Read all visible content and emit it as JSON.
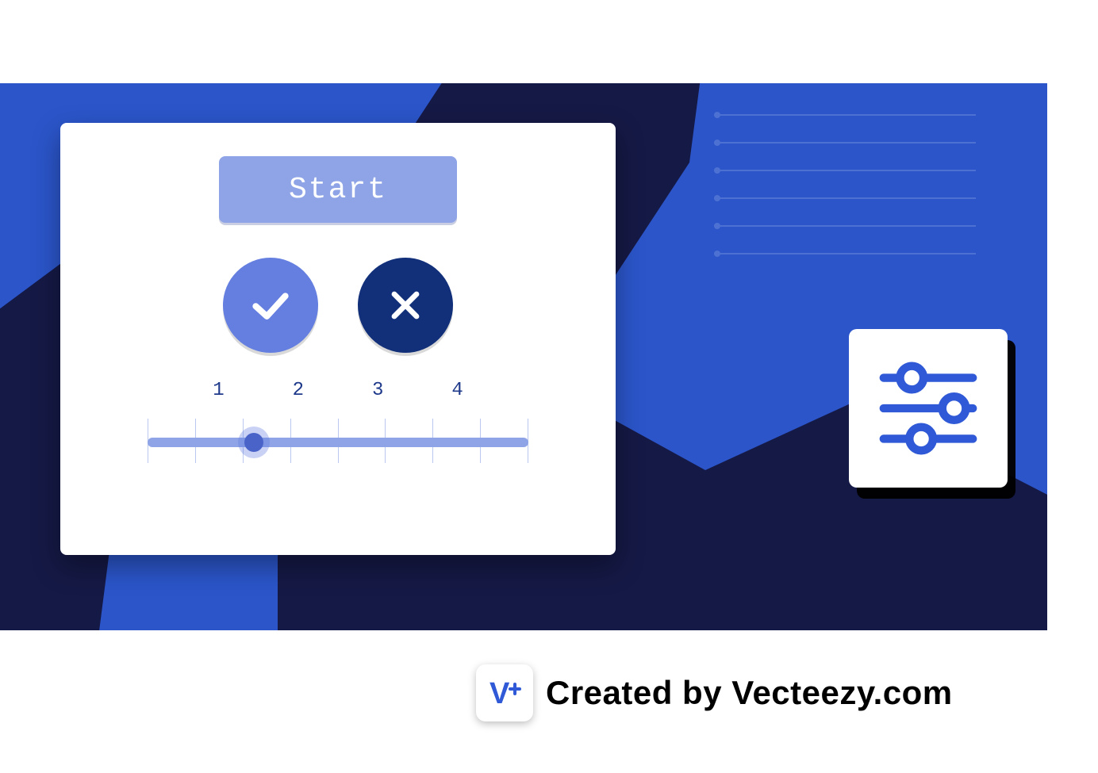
{
  "card": {
    "start_label": "Start",
    "scale_labels": [
      "1",
      "2",
      "3",
      "4"
    ],
    "slider": {
      "min": 1,
      "max": 4,
      "value": 1.5,
      "tick_count": 9,
      "thumb_percent": 28
    }
  },
  "icons": {
    "confirm": "check-icon",
    "cancel": "close-icon",
    "settings": "sliders-icon",
    "badge": "v-plus-icon"
  },
  "attribution": {
    "text": "Created by Vecteezy.com"
  },
  "colors": {
    "banner": "#2b55c9",
    "navy": "#151945",
    "button": "#8ea4e6",
    "confirm_circle": "#647fe0",
    "cancel_circle": "#12307a",
    "accent": "#2f59d6"
  }
}
